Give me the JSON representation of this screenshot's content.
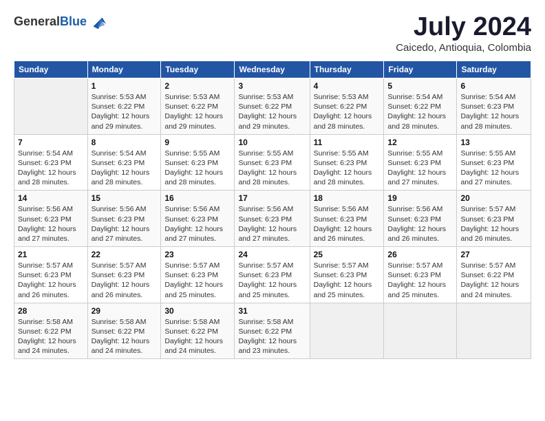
{
  "header": {
    "logo_line1": "General",
    "logo_line2": "Blue",
    "month": "July 2024",
    "location": "Caicedo, Antioquia, Colombia"
  },
  "weekdays": [
    "Sunday",
    "Monday",
    "Tuesday",
    "Wednesday",
    "Thursday",
    "Friday",
    "Saturday"
  ],
  "weeks": [
    [
      {
        "day": "",
        "info": ""
      },
      {
        "day": "1",
        "info": "Sunrise: 5:53 AM\nSunset: 6:22 PM\nDaylight: 12 hours\nand 29 minutes."
      },
      {
        "day": "2",
        "info": "Sunrise: 5:53 AM\nSunset: 6:22 PM\nDaylight: 12 hours\nand 29 minutes."
      },
      {
        "day": "3",
        "info": "Sunrise: 5:53 AM\nSunset: 6:22 PM\nDaylight: 12 hours\nand 29 minutes."
      },
      {
        "day": "4",
        "info": "Sunrise: 5:53 AM\nSunset: 6:22 PM\nDaylight: 12 hours\nand 28 minutes."
      },
      {
        "day": "5",
        "info": "Sunrise: 5:54 AM\nSunset: 6:22 PM\nDaylight: 12 hours\nand 28 minutes."
      },
      {
        "day": "6",
        "info": "Sunrise: 5:54 AM\nSunset: 6:23 PM\nDaylight: 12 hours\nand 28 minutes."
      }
    ],
    [
      {
        "day": "7",
        "info": "Sunrise: 5:54 AM\nSunset: 6:23 PM\nDaylight: 12 hours\nand 28 minutes."
      },
      {
        "day": "8",
        "info": "Sunrise: 5:54 AM\nSunset: 6:23 PM\nDaylight: 12 hours\nand 28 minutes."
      },
      {
        "day": "9",
        "info": "Sunrise: 5:55 AM\nSunset: 6:23 PM\nDaylight: 12 hours\nand 28 minutes."
      },
      {
        "day": "10",
        "info": "Sunrise: 5:55 AM\nSunset: 6:23 PM\nDaylight: 12 hours\nand 28 minutes."
      },
      {
        "day": "11",
        "info": "Sunrise: 5:55 AM\nSunset: 6:23 PM\nDaylight: 12 hours\nand 28 minutes."
      },
      {
        "day": "12",
        "info": "Sunrise: 5:55 AM\nSunset: 6:23 PM\nDaylight: 12 hours\nand 27 minutes."
      },
      {
        "day": "13",
        "info": "Sunrise: 5:55 AM\nSunset: 6:23 PM\nDaylight: 12 hours\nand 27 minutes."
      }
    ],
    [
      {
        "day": "14",
        "info": "Sunrise: 5:56 AM\nSunset: 6:23 PM\nDaylight: 12 hours\nand 27 minutes."
      },
      {
        "day": "15",
        "info": "Sunrise: 5:56 AM\nSunset: 6:23 PM\nDaylight: 12 hours\nand 27 minutes."
      },
      {
        "day": "16",
        "info": "Sunrise: 5:56 AM\nSunset: 6:23 PM\nDaylight: 12 hours\nand 27 minutes."
      },
      {
        "day": "17",
        "info": "Sunrise: 5:56 AM\nSunset: 6:23 PM\nDaylight: 12 hours\nand 27 minutes."
      },
      {
        "day": "18",
        "info": "Sunrise: 5:56 AM\nSunset: 6:23 PM\nDaylight: 12 hours\nand 26 minutes."
      },
      {
        "day": "19",
        "info": "Sunrise: 5:56 AM\nSunset: 6:23 PM\nDaylight: 12 hours\nand 26 minutes."
      },
      {
        "day": "20",
        "info": "Sunrise: 5:57 AM\nSunset: 6:23 PM\nDaylight: 12 hours\nand 26 minutes."
      }
    ],
    [
      {
        "day": "21",
        "info": "Sunrise: 5:57 AM\nSunset: 6:23 PM\nDaylight: 12 hours\nand 26 minutes."
      },
      {
        "day": "22",
        "info": "Sunrise: 5:57 AM\nSunset: 6:23 PM\nDaylight: 12 hours\nand 26 minutes."
      },
      {
        "day": "23",
        "info": "Sunrise: 5:57 AM\nSunset: 6:23 PM\nDaylight: 12 hours\nand 25 minutes."
      },
      {
        "day": "24",
        "info": "Sunrise: 5:57 AM\nSunset: 6:23 PM\nDaylight: 12 hours\nand 25 minutes."
      },
      {
        "day": "25",
        "info": "Sunrise: 5:57 AM\nSunset: 6:23 PM\nDaylight: 12 hours\nand 25 minutes."
      },
      {
        "day": "26",
        "info": "Sunrise: 5:57 AM\nSunset: 6:23 PM\nDaylight: 12 hours\nand 25 minutes."
      },
      {
        "day": "27",
        "info": "Sunrise: 5:57 AM\nSunset: 6:22 PM\nDaylight: 12 hours\nand 24 minutes."
      }
    ],
    [
      {
        "day": "28",
        "info": "Sunrise: 5:58 AM\nSunset: 6:22 PM\nDaylight: 12 hours\nand 24 minutes."
      },
      {
        "day": "29",
        "info": "Sunrise: 5:58 AM\nSunset: 6:22 PM\nDaylight: 12 hours\nand 24 minutes."
      },
      {
        "day": "30",
        "info": "Sunrise: 5:58 AM\nSunset: 6:22 PM\nDaylight: 12 hours\nand 24 minutes."
      },
      {
        "day": "31",
        "info": "Sunrise: 5:58 AM\nSunset: 6:22 PM\nDaylight: 12 hours\nand 23 minutes."
      },
      {
        "day": "",
        "info": ""
      },
      {
        "day": "",
        "info": ""
      },
      {
        "day": "",
        "info": ""
      }
    ]
  ]
}
